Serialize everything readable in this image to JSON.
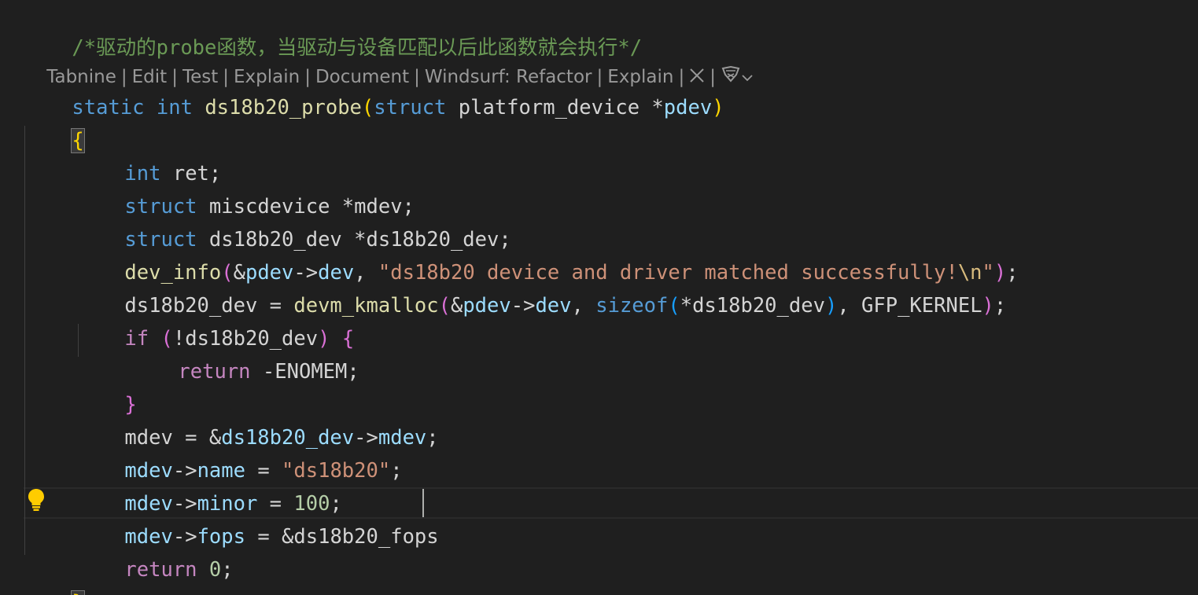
{
  "comment": "/*驱动的probe函数，当驱动与设备匹配以后此函数就会执行*/",
  "codelens": {
    "tabnine": "Tabnine",
    "edit": "Edit",
    "test": "Test",
    "explain": "Explain",
    "document": "Document",
    "windsurf_refactor": "Windsurf: Refactor",
    "windsurf_explain": "Explain",
    "separator": "|"
  },
  "code": {
    "l1": {
      "static": "static",
      "int": "int",
      "fname": "ds18b20_probe",
      "lp": "(",
      "struct": "struct",
      "type": "platform_device",
      "star": "*",
      "pdev": "pdev",
      "rp": ")"
    },
    "l2": {
      "brace": "{"
    },
    "l3": {
      "int": "int",
      "rest": "ret;"
    },
    "l4": {
      "struct": "struct",
      "rest": "miscdevice *mdev;"
    },
    "l5": {
      "struct": "struct",
      "rest": "ds18b20_dev *ds18b20_dev;"
    },
    "l6": {
      "fn": "dev_info",
      "lp": "(",
      "amp": "&",
      "pdev": "pdev",
      "arrow": "->",
      "dev": "dev",
      "comma": ", ",
      "str": "\"ds18b20 device and driver matched successfully!",
      "esc": "\\n",
      "strend": "\"",
      "rp": ")",
      "semi": ";"
    },
    "l7": {
      "lhs": "ds18b20_dev = ",
      "fn": "devm_kmalloc",
      "lp": "(",
      "amp": "&",
      "pdev": "pdev",
      "arrow": "->",
      "dev": "dev",
      "comma": ", ",
      "sizeof": "sizeof",
      "lp2": "(",
      "arg": "*ds18b20_dev",
      "rp2": ")",
      "rest": ", GFP_KERNEL",
      "rp": ")",
      "semi": ";"
    },
    "l8": {
      "if": "if",
      "lp": "(",
      "cond": "!ds18b20_dev",
      "rp": ")",
      "brace": "{"
    },
    "l9": {
      "return": "return",
      "rest": "-ENOMEM;"
    },
    "l10": {
      "brace": "}"
    },
    "l11": {
      "lhs": "mdev = &",
      "obj": "ds18b20_dev",
      "arrow": "->",
      "field": "mdev",
      "semi": ";"
    },
    "l12": {
      "obj": "mdev",
      "arrow": "->",
      "field": "name",
      "eq": " = ",
      "str": "\"ds18b20\"",
      "semi": ";"
    },
    "l13": {
      "obj": "mdev",
      "arrow": "->",
      "field": "minor",
      "eq": " = ",
      "num": "100",
      "semi": ";"
    },
    "l14": {
      "obj": "mdev",
      "arrow": "->",
      "field": "fops",
      "rest": " = &ds18b20_fops"
    },
    "l15": {
      "return": "return",
      "num": "0",
      "semi": ";"
    },
    "l16": {
      "brace": "}"
    }
  },
  "icons": {
    "lightbulb": "lightbulb-icon",
    "close": "close-icon",
    "windsurf": "windsurf-icon",
    "chevron": "chevron-down-icon"
  },
  "colors": {
    "background": "#1f1f1f",
    "comment": "#6a9955",
    "keyword": "#569cd6",
    "control": "#c586c0",
    "function": "#dcdcaa",
    "variable": "#9cdcfe",
    "string": "#ce9178",
    "number": "#b5cea8",
    "bracket_gold": "#ffd700",
    "bracket_orchid": "#da70d6",
    "bracket_blue": "#179fff",
    "lightbulb": "#ffcc00"
  }
}
